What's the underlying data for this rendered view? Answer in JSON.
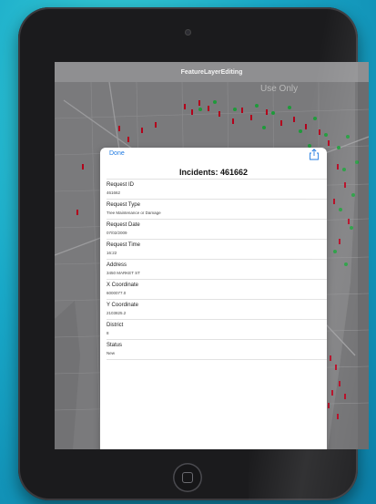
{
  "app": {
    "title": "FeatureLayerEditing"
  },
  "map": {
    "watermark": "Use Only"
  },
  "popup": {
    "done_label": "Done",
    "share_icon": "share-icon",
    "title": "Incidents: 461662",
    "fields": [
      {
        "label": "Request ID",
        "value": "461662"
      },
      {
        "label": "Request Type",
        "value": "Tree Maintenance or Damage"
      },
      {
        "label": "Request Date",
        "value": "07/02/2009"
      },
      {
        "label": "Request Time",
        "value": "16:22"
      },
      {
        "label": "Address",
        "value": "3450 MARKET ST"
      },
      {
        "label": "X Coordinate",
        "value": "6000077.0"
      },
      {
        "label": "Y Coordinate",
        "value": "2103825.2"
      },
      {
        "label": "District",
        "value": "8"
      },
      {
        "label": "Status",
        "value": "New"
      }
    ]
  },
  "colors": {
    "accent": "#1f7ae0",
    "marker_red": "#b3001b",
    "marker_green": "#1e9a3a",
    "background_teal": "#19a9c9"
  }
}
